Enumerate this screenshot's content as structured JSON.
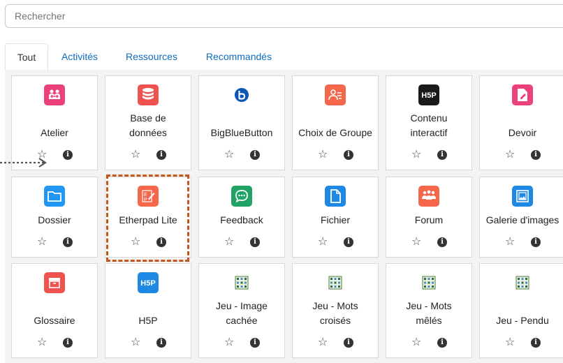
{
  "search": {
    "placeholder": "Rechercher"
  },
  "tabs": [
    {
      "label": "Tout",
      "active": true
    },
    {
      "label": "Activités",
      "active": false
    },
    {
      "label": "Ressources",
      "active": false
    },
    {
      "label": "Recommandés",
      "active": false
    }
  ],
  "modules": [
    {
      "id": "atelier",
      "name": "Atelier",
      "icon": "workshop-icon",
      "color": "#ec407a"
    },
    {
      "id": "base-de-donnees",
      "name": "Base de données",
      "icon": "database-icon",
      "color": "#ef5350"
    },
    {
      "id": "bigbluebutton",
      "name": "BigBlueButton",
      "icon": "bigbluebutton-icon",
      "color": "#0a55b6"
    },
    {
      "id": "choix-de-groupe",
      "name": "Choix de Groupe",
      "icon": "group-choice-icon",
      "color": "#f4674b"
    },
    {
      "id": "contenu-interactif",
      "name": "Contenu interactif",
      "icon": "h5p-icon",
      "color": "#1a1a1a"
    },
    {
      "id": "devoir",
      "name": "Devoir",
      "icon": "assignment-icon",
      "color": "#ec407a"
    },
    {
      "id": "dossier",
      "name": "Dossier",
      "icon": "folder-icon",
      "color": "#2196f3"
    },
    {
      "id": "etherpad-lite",
      "name": "Etherpad Lite",
      "icon": "etherpad-icon",
      "color": "#f4674b"
    },
    {
      "id": "feedback",
      "name": "Feedback",
      "icon": "feedback-icon",
      "color": "#21a366"
    },
    {
      "id": "fichier",
      "name": "Fichier",
      "icon": "file-icon",
      "color": "#1e88e5"
    },
    {
      "id": "forum",
      "name": "Forum",
      "icon": "forum-icon",
      "color": "#f4674b"
    },
    {
      "id": "galerie-d-images",
      "name": "Galerie d'images",
      "icon": "image-gallery-icon",
      "color": "#1e88e5"
    },
    {
      "id": "glossaire",
      "name": "Glossaire",
      "icon": "glossary-icon",
      "color": "#ef5350"
    },
    {
      "id": "h5p",
      "name": "H5P",
      "icon": "h5p-icon",
      "color": "#1e88e5"
    },
    {
      "id": "jeu-image-cachee",
      "name": "Jeu - Image cachée",
      "icon": "game-icon",
      "color": "#4a7c3f"
    },
    {
      "id": "jeu-mots-croises",
      "name": "Jeu - Mots croisés",
      "icon": "game-icon",
      "color": "#4a7c3f"
    },
    {
      "id": "jeu-mots-meles",
      "name": "Jeu - Mots mêlés",
      "icon": "game-icon",
      "color": "#4a7c3f"
    },
    {
      "id": "jeu-pendu",
      "name": "Jeu - Pendu",
      "icon": "game-icon",
      "color": "#4a7c3f"
    }
  ],
  "highlight_color": "#c3561a"
}
